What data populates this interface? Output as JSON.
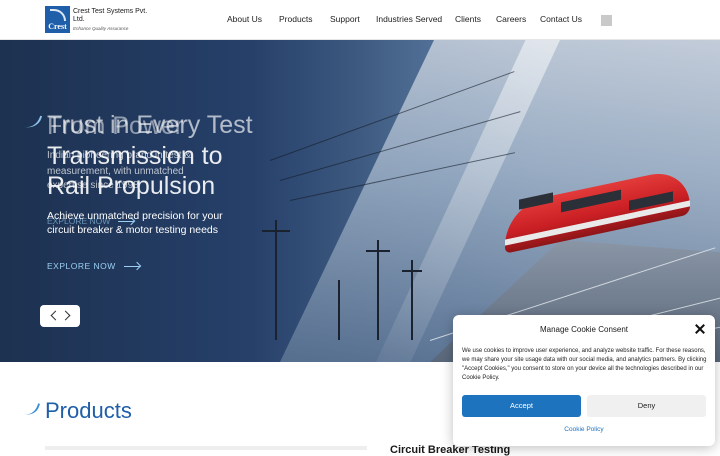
{
  "brand": {
    "name": "Crest Test Systems Pvt. Ltd.",
    "logo_text": "Crest",
    "tagline": "Enhance Quality Assurance"
  },
  "nav": {
    "items": [
      "About Us",
      "Products",
      "Support",
      "Industries Served",
      "Clients",
      "Careers",
      "Contact Us"
    ]
  },
  "hero": {
    "slide_current": {
      "title_line1": "From Power",
      "title_line2": "Transmission to",
      "title_line3": "Rail Propulsion",
      "subtitle": "Achieve unmatched precision for your circuit breaker & motor testing needs",
      "cta": "EXPLORE NOW"
    },
    "slide_fading": {
      "title_line1": "Trust in Every Test",
      "subtitle_line1": "Indian pioneering brand in test &",
      "subtitle_line2": "measurement, with unmatched",
      "subtitle_line3": "expertise since 1998",
      "cta": "EXPLORE NOW"
    }
  },
  "products": {
    "title": "Products",
    "first_heading": "Circuit Breaker Testing"
  },
  "cookie": {
    "title": "Manage Cookie Consent",
    "body": "We use cookies to improve user experience, and analyze website traffic. For these reasons, we may share your site usage data with our social media, and analytics partners. By clicking \"Accept Cookies,\" you consent to store on your device all the technologies described in our Cookie Policy.",
    "accept_label": "Accept",
    "deny_label": "Deny",
    "policy_label": "Cookie Policy"
  },
  "colors": {
    "brand_blue": "#1f5ea8",
    "accept_blue": "#1e73be",
    "cta_blue": "#9bd0f2",
    "train_red": "#c91f24"
  }
}
